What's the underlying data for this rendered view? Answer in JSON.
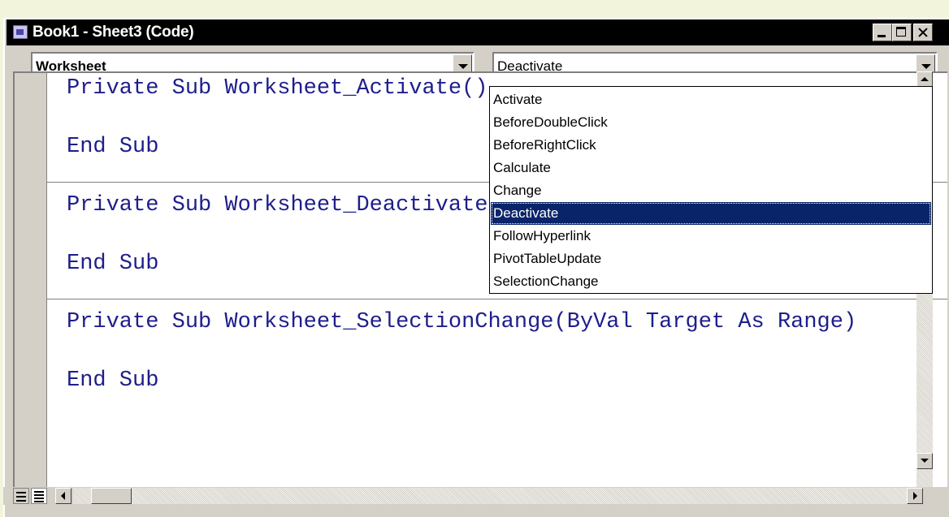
{
  "window": {
    "title": "Book1 - Sheet3 (Code)"
  },
  "object_combo": {
    "value": "Worksheet"
  },
  "procedure_combo": {
    "value": "Deactivate",
    "options": [
      "Activate",
      "BeforeDoubleClick",
      "BeforeRightClick",
      "Calculate",
      "Change",
      "Deactivate",
      "FollowHyperlink",
      "PivotTableUpdate",
      "SelectionChange"
    ],
    "selected_index": 5
  },
  "code": {
    "lines": [
      "Private Sub Worksheet_Activate()",
      "End Sub",
      "Private Sub Worksheet_Deactivate()",
      "End Sub",
      "Private Sub Worksheet_SelectionChange(ByVal Target As Range)",
      "End Sub"
    ]
  },
  "colors": {
    "title_bar": "#000000",
    "code_text": "#1e1e8c",
    "selection": "#0a246a",
    "chrome": "#d4d0c8"
  },
  "icons": {
    "app": "vba-module-icon",
    "minimize": "minimize-icon",
    "maximize": "maximize-icon",
    "close": "close-icon"
  }
}
